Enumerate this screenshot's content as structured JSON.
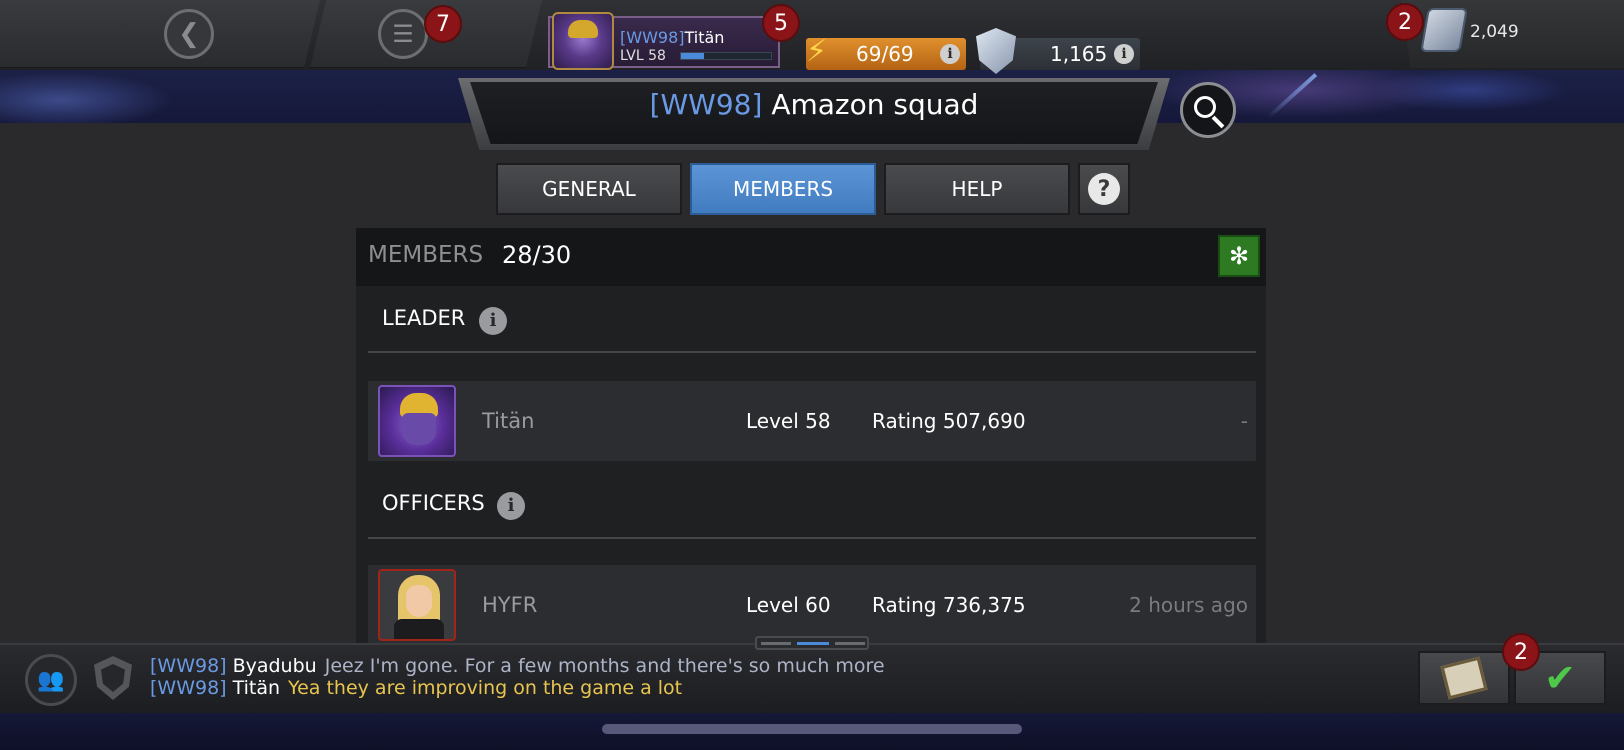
{
  "topbar": {
    "menu_badge": "7",
    "profile": {
      "alliance_tag": "[WW98]",
      "name": "Titän",
      "level": "LVL 58",
      "xp_fraction": 0.25,
      "badge": "5"
    },
    "energy": {
      "value": "69/69",
      "info": "i"
    },
    "battlechips": {
      "value": "1,165",
      "info": "i"
    },
    "units": {
      "value": "2,049",
      "badge": "2"
    }
  },
  "header": {
    "alliance_tag": "[WW98]",
    "alliance_name": "Amazon squad"
  },
  "tabs": [
    {
      "label": "GENERAL",
      "active": false
    },
    {
      "label": "MEMBERS",
      "active": true
    },
    {
      "label": "HELP",
      "active": false
    }
  ],
  "help_glyph": "?",
  "members_panel": {
    "label": "MEMBERS",
    "count": "28/30",
    "sections": {
      "leader": {
        "title": "LEADER",
        "info": "i",
        "member": {
          "name": "Titän",
          "level": "Level 58",
          "rating": "Rating 507,690",
          "last_seen": "-"
        }
      },
      "officers": {
        "title": "OFFICERS",
        "info": "i",
        "member": {
          "name": "HYFR",
          "level": "Level 60",
          "rating": "Rating 736,375",
          "last_seen": "2 hours ago"
        }
      }
    }
  },
  "chat": {
    "messages": [
      {
        "tag": "[WW98]",
        "sender": "Byadubu",
        "text": "Jeez I'm gone. For a few months and there's so much more"
      },
      {
        "tag": "[WW98]",
        "sender": "Titän",
        "text": "Yea they are improving on the game a lot"
      }
    ],
    "quests_badge": "2"
  },
  "colors": {
    "accent_blue": "#5b95d6",
    "tag_blue": "#6b9ae4",
    "badge_red": "#8a1418",
    "energy_orange": "#e0902c",
    "hydra_green": "#2d7a22",
    "chat_yellow": "#e8c450"
  },
  "icons": {
    "back": "back-arrow-icon",
    "menu": "hamburger-menu-icon",
    "energy": "lightning-bolt-icon",
    "battlechips": "shield-icon",
    "units": "units-icon",
    "search": "search-icon",
    "help": "question-icon",
    "hydra": "hydra-icon",
    "alliance_members": "people-icon",
    "alliance_chat": "alliance-shield-icon",
    "quests": "clipboard-icon",
    "complete": "checkmark-icon"
  }
}
